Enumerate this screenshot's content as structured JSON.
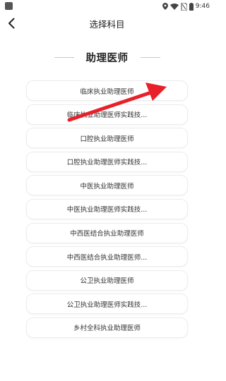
{
  "status_bar": {
    "time": "9:46",
    "icons": [
      "location-icon",
      "wifi-icon",
      "no-sim-icon",
      "battery-icon"
    ]
  },
  "header": {
    "title": "选择科目",
    "back_icon": "chevron-left-icon"
  },
  "section": {
    "heading": "助理医师"
  },
  "subjects": [
    {
      "label": "临床执业助理医师"
    },
    {
      "label": "临床执业助理医师实践技..."
    },
    {
      "label": "口腔执业助理医师"
    },
    {
      "label": "口腔执业助理医师实践技..."
    },
    {
      "label": "中医执业助理医师"
    },
    {
      "label": "中医执业助理医师实践技..."
    },
    {
      "label": "中西医结合执业助理医师"
    },
    {
      "label": "中西医结合执业助理医师..."
    },
    {
      "label": "公卫执业助理医师"
    },
    {
      "label": "公卫执业助理医师实践技..."
    },
    {
      "label": "乡村全科执业助理医师"
    }
  ],
  "annotation": {
    "arrow_color": "#e8202a"
  }
}
